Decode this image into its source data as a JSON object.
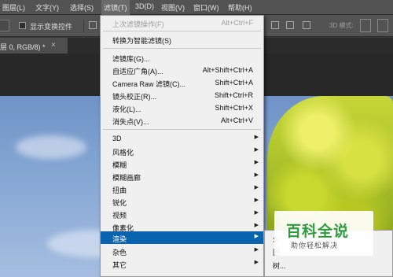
{
  "menubar": {
    "items": [
      "图层(L)",
      "文字(Y)",
      "选择(S)",
      "滤镜(T)",
      "3D(D)",
      "视图(V)",
      "窗口(W)",
      "帮助(H)"
    ]
  },
  "options": {
    "show_transform_label": "显示变换控件",
    "mode_label": "3D 模式:"
  },
  "document_tab": {
    "label": "层 0, RGB/8) *",
    "close": "×"
  },
  "filter_menu": {
    "items": [
      {
        "label": "上次滤镜操作(F)",
        "shortcut": "Alt+Ctrl+F"
      },
      {
        "label": "转换为智能滤镜(S)",
        "shortcut": ""
      },
      {
        "label": "滤镜库(G)...",
        "shortcut": ""
      },
      {
        "label": "自适应广角(A)...",
        "shortcut": "Alt+Shift+Ctrl+A"
      },
      {
        "label": "Camera Raw 滤镜(C)...",
        "shortcut": "Shift+Ctrl+A"
      },
      {
        "label": "镜头校正(R)...",
        "shortcut": "Shift+Ctrl+R"
      },
      {
        "label": "液化(L)...",
        "shortcut": "Shift+Ctrl+X"
      },
      {
        "label": "消失点(V)...",
        "shortcut": "Alt+Ctrl+V"
      },
      {
        "label": "3D",
        "shortcut": ""
      },
      {
        "label": "风格化",
        "shortcut": ""
      },
      {
        "label": "模糊",
        "shortcut": ""
      },
      {
        "label": "模糊画廊",
        "shortcut": ""
      },
      {
        "label": "扭曲",
        "shortcut": ""
      },
      {
        "label": "锐化",
        "shortcut": ""
      },
      {
        "label": "视频",
        "shortcut": ""
      },
      {
        "label": "像素化",
        "shortcut": ""
      },
      {
        "label": "渲染",
        "shortcut": ""
      },
      {
        "label": "杂色",
        "shortcut": ""
      },
      {
        "label": "其它",
        "shortcut": ""
      }
    ]
  },
  "submenu": {
    "items": [
      "火",
      "图",
      "树..."
    ]
  },
  "watermark": {
    "title": "百科全说",
    "subtitle": "助你轻松解决"
  },
  "colors": {
    "menu_bg": "#f0f0f0",
    "highlight": "#0a64ad",
    "chrome": "#535353",
    "watermark_green": "#2e9b3e"
  }
}
